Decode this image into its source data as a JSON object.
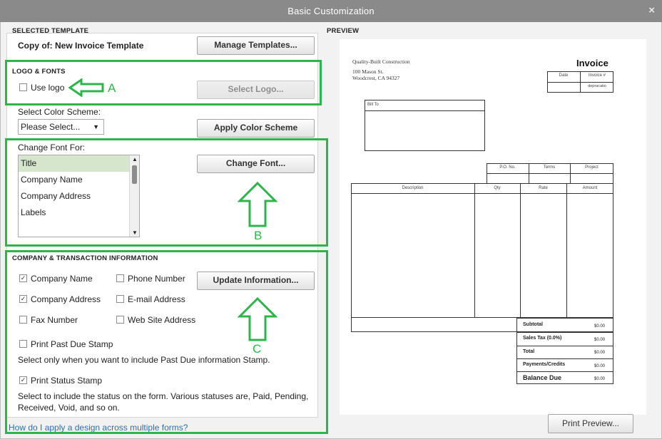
{
  "window": {
    "title": "Basic Customization",
    "close_label": "×"
  },
  "selected_template": {
    "header": "SELECTED TEMPLATE",
    "name": "Copy of: New Invoice Template",
    "manage_button": "Manage Templates..."
  },
  "logo_fonts": {
    "header": "LOGO & FONTS",
    "use_logo_label": "Use logo",
    "use_logo_checked": false,
    "select_logo_button": "Select Logo...",
    "color_scheme_label": "Select Color Scheme:",
    "color_scheme_value": "Please Select...",
    "apply_color_button": "Apply Color Scheme",
    "change_font_for_label": "Change Font For:",
    "font_items": [
      "Title",
      "Company Name",
      "Company Address",
      "Labels"
    ],
    "font_selected": "Title",
    "change_font_button": "Change Font..."
  },
  "company_info": {
    "header": "COMPANY & TRANSACTION INFORMATION",
    "company_name": {
      "label": "Company Name",
      "checked": true
    },
    "phone_number": {
      "label": "Phone Number",
      "checked": false
    },
    "company_address": {
      "label": "Company Address",
      "checked": true
    },
    "email_address": {
      "label": "E-mail Address",
      "checked": false
    },
    "fax_number": {
      "label": "Fax Number",
      "checked": false
    },
    "website_address": {
      "label": "Web Site Address",
      "checked": false
    },
    "update_button": "Update Information...",
    "past_due": {
      "label": "Print Past Due Stamp",
      "checked": false
    },
    "past_due_help": "Select only when you want to include Past Due information Stamp.",
    "status_stamp": {
      "label": "Print Status Stamp",
      "checked": true
    },
    "status_help_line1": "Select to include the status on the form. Various statuses are, Paid, Pending,",
    "status_help_line2": "Received, Void, and so on."
  },
  "help_link": "How do I apply a design across multiple forms?",
  "annotations": {
    "a": "A",
    "b": "B",
    "c": "C",
    "color": "#2db54b"
  },
  "preview": {
    "header": "PREVIEW",
    "company_name": "Quality-Built Construction",
    "address_line1": "100 Mason St.",
    "address_line2": "Woodcrest, CA 94327",
    "doc_title": "Invoice",
    "date_label": "Date",
    "invoice_no_label": "Invoice #",
    "invoice_no_value": "depracatio",
    "bill_to_label": "Bill To",
    "po_label": "P.O. No.",
    "terms_label": "Terms",
    "project_label": "Project",
    "col_description": "Description",
    "col_qty": "Qty",
    "col_rate": "Rate",
    "col_amount": "Amount",
    "subtotal_label": "Subtotal",
    "sales_tax_label": "Sales Tax  (0.0%)",
    "total_label": "Total",
    "payments_label": "Payments/Credits",
    "balance_label": "Balance Due",
    "zero_value": "$0.00",
    "print_preview_button": "Print Preview..."
  }
}
